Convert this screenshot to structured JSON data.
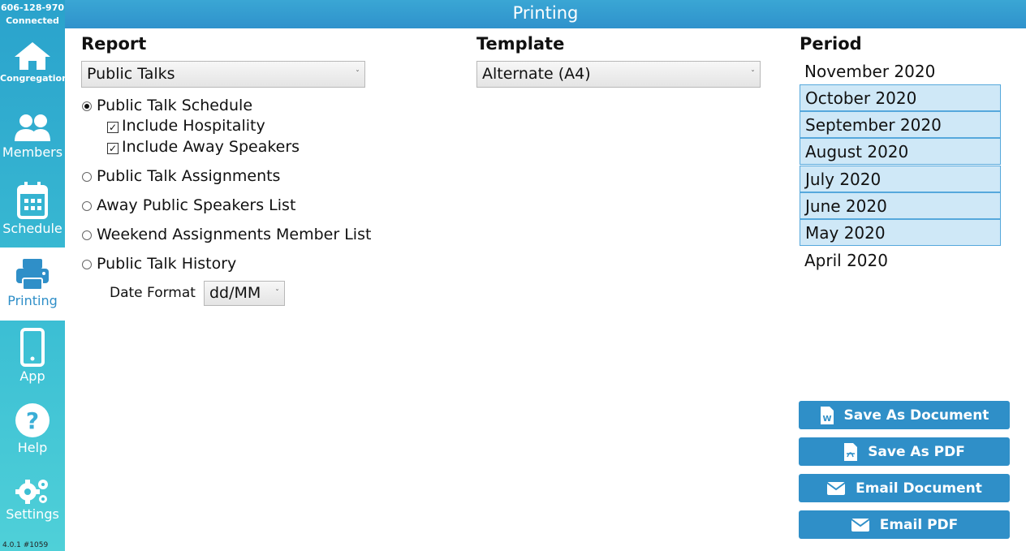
{
  "connection": {
    "id": "606-128-970",
    "status": "Connected"
  },
  "version": "4.0.1 #1059",
  "header": {
    "title": "Printing"
  },
  "sidebar": {
    "items": [
      {
        "label": "Congregation",
        "icon": "home-icon"
      },
      {
        "label": "Members",
        "icon": "members-icon"
      },
      {
        "label": "Schedule",
        "icon": "calendar-icon"
      },
      {
        "label": "Printing",
        "icon": "printer-icon",
        "active": true
      },
      {
        "label": "App",
        "icon": "phone-icon"
      },
      {
        "label": "Help",
        "icon": "help-icon"
      },
      {
        "label": "Settings",
        "icon": "gears-icon"
      }
    ]
  },
  "report": {
    "title": "Report",
    "selected": "Public Talks",
    "options": [
      {
        "label": "Public Talk Schedule",
        "checked": true
      },
      {
        "label": "Public Talk Assignments",
        "checked": false
      },
      {
        "label": "Away Public Speakers List",
        "checked": false
      },
      {
        "label": "Weekend Assignments Member List",
        "checked": false
      },
      {
        "label": "Public Talk History",
        "checked": false
      }
    ],
    "sub_options": [
      {
        "label": "Include Hospitality",
        "checked": true
      },
      {
        "label": "Include Away Speakers",
        "checked": true
      }
    ],
    "date_format": {
      "label": "Date Format",
      "value": "dd/MM"
    }
  },
  "template": {
    "title": "Template",
    "selected": "Alternate (A4)"
  },
  "period": {
    "title": "Period",
    "items": [
      {
        "label": "November 2020",
        "selected": false
      },
      {
        "label": "October 2020",
        "selected": true
      },
      {
        "label": "September 2020",
        "selected": true
      },
      {
        "label": "August 2020",
        "selected": true
      },
      {
        "label": "July 2020",
        "selected": true
      },
      {
        "label": "June 2020",
        "selected": true
      },
      {
        "label": "May 2020",
        "selected": true
      },
      {
        "label": "April 2020",
        "selected": false
      }
    ]
  },
  "actions": {
    "save_doc": "Save As Document",
    "save_pdf": "Save As PDF",
    "email_doc": "Email Document",
    "email_pdf": "Email PDF"
  },
  "colors": {
    "accent": "#2f8fc8",
    "selection": "#cfe8f7",
    "sidebar": "#3cbfd4"
  }
}
